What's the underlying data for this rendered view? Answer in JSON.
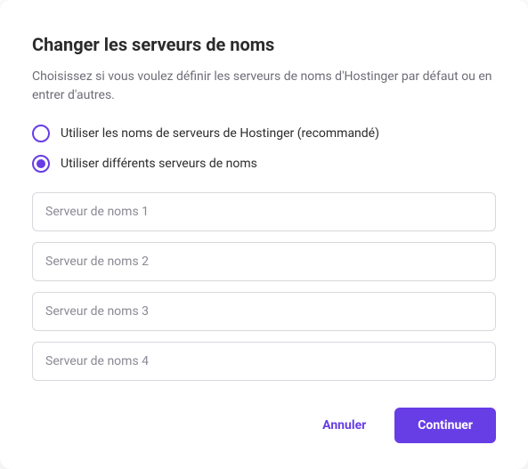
{
  "modal": {
    "title": "Changer les serveurs de noms",
    "description": "Choisissez si vous voulez définir les serveurs de noms d'Hostinger par défaut ou en entrer d'autres."
  },
  "radio": {
    "options": [
      {
        "label": "Utiliser les noms de serveurs de Hostinger (recommandé)",
        "selected": false
      },
      {
        "label": "Utiliser différents serveurs de noms",
        "selected": true
      }
    ]
  },
  "inputs": [
    {
      "placeholder": "Serveur de noms 1",
      "value": ""
    },
    {
      "placeholder": "Serveur de noms 2",
      "value": ""
    },
    {
      "placeholder": "Serveur de noms 3",
      "value": ""
    },
    {
      "placeholder": "Serveur de noms 4",
      "value": ""
    }
  ],
  "buttons": {
    "cancel": "Annuler",
    "continue": "Continuer"
  },
  "colors": {
    "accent": "#673de6"
  }
}
